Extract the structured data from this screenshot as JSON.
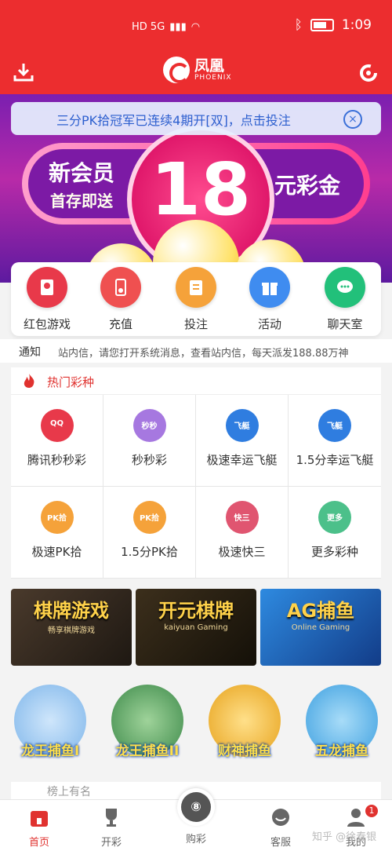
{
  "status_bar": {
    "time": "1:09",
    "network": "HD 5G"
  },
  "header": {
    "logo_cn": "凤凰",
    "logo_en": "PHOENIX"
  },
  "banner": {
    "left_line1": "新会员",
    "left_line2": "首存即送",
    "number": "18",
    "right_text": "元彩金"
  },
  "notice": {
    "text": "三分PK拾冠军已连续4期开[双]，点击投注"
  },
  "quick_menu": [
    {
      "label": "红包游戏",
      "color": "#e8394a",
      "icon": "red-envelope-icon"
    },
    {
      "label": "充值",
      "color": "#ef5050",
      "icon": "phone-recharge-icon"
    },
    {
      "label": "投注",
      "color": "#f5a23a",
      "icon": "clipboard-icon"
    },
    {
      "label": "活动",
      "color": "#3f8cf0",
      "icon": "gift-icon"
    },
    {
      "label": "聊天室",
      "color": "#22c07a",
      "icon": "chat-bubble-icon"
    }
  ],
  "ticker": {
    "label": "通知",
    "message": "站内信，请您打开系统消息，查看站内信，每天派发188.88万神"
  },
  "hot": {
    "title": "热门彩种"
  },
  "lotteries": [
    {
      "label": "腾讯秒秒彩",
      "icon_text": "QQ",
      "color": "#e8394a"
    },
    {
      "label": "秒秒彩",
      "icon_text": "秒秒",
      "color": "#a678e0"
    },
    {
      "label": "极速幸运飞艇",
      "icon_text": "飞艇",
      "color": "#2f7de0"
    },
    {
      "label": "1.5分幸运飞艇",
      "icon_text": "飞艇",
      "color": "#2f7de0"
    },
    {
      "label": "极速PK拾",
      "icon_text": "PK拾",
      "color": "#f5a23a"
    },
    {
      "label": "1.5分PK拾",
      "icon_text": "PK拾",
      "color": "#f5a23a"
    },
    {
      "label": "极速快三",
      "icon_text": "快三",
      "color": "#e05570"
    },
    {
      "label": "更多彩种",
      "icon_text": "更多",
      "color": "#4cc08a"
    }
  ],
  "games": [
    {
      "title": "棋牌游戏",
      "subtitle": "畅享棋牌游戏",
      "bg": "#3a2c22"
    },
    {
      "title": "开元棋牌",
      "subtitle": "kaiyuan Gaming",
      "bg": "#2b2418"
    },
    {
      "title": "AG捕鱼",
      "subtitle": "Online Gaming",
      "bg": "#1d5fb8"
    }
  ],
  "fishing": [
    {
      "title": "龙王捕鱼I",
      "color": "#7fb6ea"
    },
    {
      "title": "龙王捕鱼II",
      "color": "#3d8a4a"
    },
    {
      "title": "财神捕鱼",
      "color": "#e7a21c"
    },
    {
      "title": "五龙捕鱼",
      "color": "#3ea0e0"
    }
  ],
  "rank": {
    "title": "榜上有名"
  },
  "tabs": [
    {
      "label": "首页",
      "active": true
    },
    {
      "label": "开彩",
      "active": false
    },
    {
      "label": "购彩",
      "active": false
    },
    {
      "label": "客服",
      "active": false
    },
    {
      "label": "我的",
      "active": false,
      "badge": "1"
    }
  ],
  "watermark": "知乎 @徐春银"
}
